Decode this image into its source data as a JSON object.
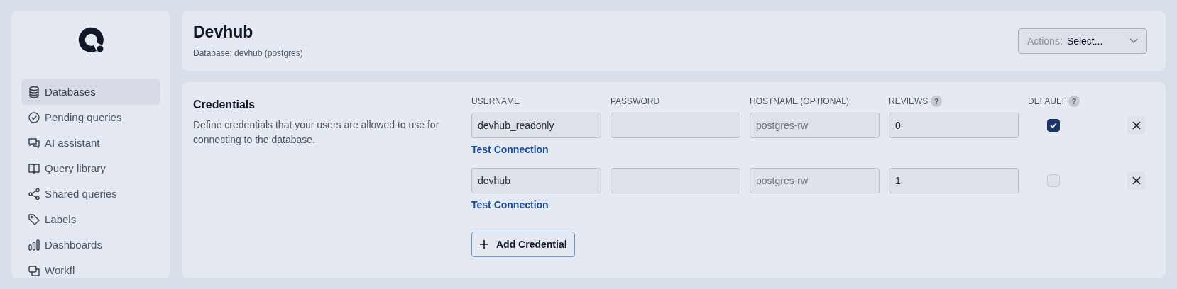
{
  "sidebar": {
    "items": [
      {
        "label": "Databases",
        "selected": true
      },
      {
        "label": "Pending queries",
        "selected": false
      },
      {
        "label": "AI assistant",
        "selected": false
      },
      {
        "label": "Query library",
        "selected": false
      },
      {
        "label": "Shared queries",
        "selected": false
      },
      {
        "label": "Labels",
        "selected": false
      },
      {
        "label": "Dashboards",
        "selected": false
      },
      {
        "label": "Workfl",
        "selected": false
      }
    ]
  },
  "header": {
    "title": "Devhub",
    "subtitle": "Database: devhub (postgres)",
    "actions": {
      "label": "Actions:",
      "value": "Select..."
    }
  },
  "credentials": {
    "title": "Credentials",
    "description": "Define credentials that your users are allowed to use for connecting to the database.",
    "columns": [
      {
        "label": "USERNAME"
      },
      {
        "label": "PASSWORD"
      },
      {
        "label": "HOSTNAME (OPTIONAL)"
      },
      {
        "label": "REVIEWS",
        "help": "?"
      },
      {
        "label": "DEFAULT",
        "help": "?"
      }
    ],
    "rows": [
      {
        "username": "devhub_readonly",
        "hostname_placeholder": "postgres-rw",
        "reviews": "0",
        "default": true,
        "link": "Test Connection"
      },
      {
        "username": "devhub",
        "hostname_placeholder": "postgres-rw",
        "reviews": "1",
        "default": false,
        "link": "Test Connection"
      }
    ],
    "add_button": "Add Credential"
  }
}
